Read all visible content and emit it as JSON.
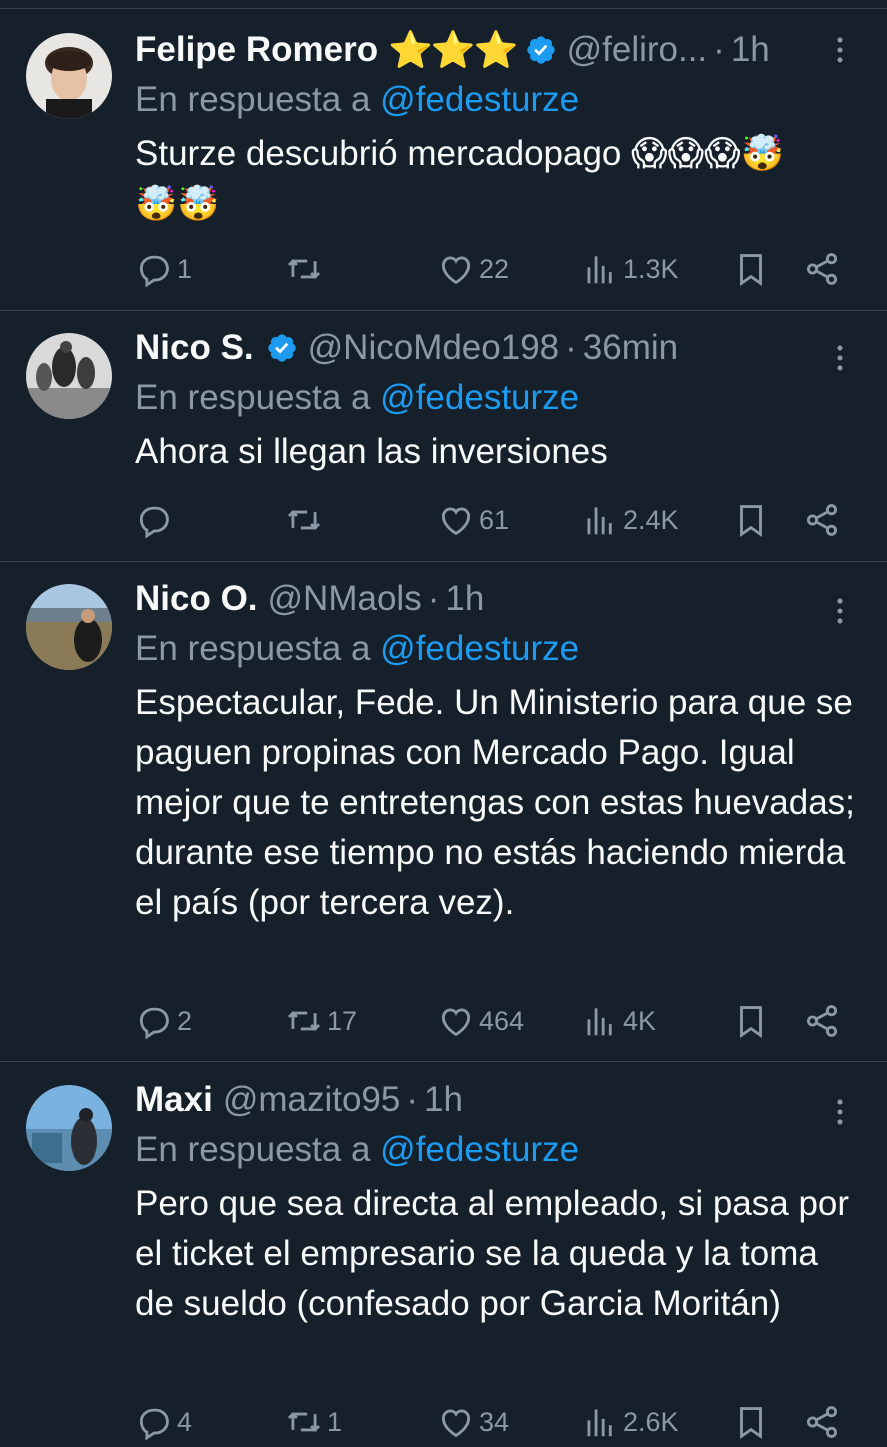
{
  "tweets": [
    {
      "name": "Felipe Romero",
      "stars": "⭐⭐⭐",
      "verified": true,
      "handle": "@feliro...",
      "time": "1h",
      "reply_prefix": "En respuesta a",
      "reply_to": "@fedesturze",
      "text": "Sturze descubrió mercadopago 😱😱😱🤯",
      "text_line2": "🤯🤯",
      "replies": "1",
      "retweets": "",
      "likes": "22",
      "views": "1.3K"
    },
    {
      "name": "Nico S.",
      "verified": true,
      "handle": "@NicoMdeo198",
      "time": "36min",
      "reply_prefix": "En respuesta a",
      "reply_to": "@fedesturze",
      "text": "Ahora si llegan las inversiones",
      "replies": "",
      "retweets": "",
      "likes": "61",
      "views": "2.4K"
    },
    {
      "name": "Nico O.",
      "verified": false,
      "handle": "@NMaols",
      "time": "1h",
      "reply_prefix": "En respuesta a",
      "reply_to": "@fedesturze",
      "text": "Espectacular, Fede. Un Ministerio para que se paguen propinas con Mercado Pago. Igual mejor que te entretengas con estas huevadas; durante ese tiempo no estás haciendo mierda el país (por tercera vez).",
      "replies": "2",
      "retweets": "17",
      "likes": "464",
      "views": "4K"
    },
    {
      "name": "Maxi",
      "verified": false,
      "handle": "@mazito95",
      "time": "1h",
      "reply_prefix": "En respuesta a",
      "reply_to": "@fedesturze",
      "text": "Pero que sea directa al empleado, si pasa por el ticket el empresario se la queda y la toma de sueldo (confesado por Garcia Moritán)",
      "replies": "4",
      "retweets": "1",
      "likes": "34",
      "views": "2.6K"
    }
  ],
  "time_separator": "·",
  "colors": {
    "background": "#15202b",
    "text": "#f7f9f9",
    "secondary": "#8b98a5",
    "link": "#1d9bf0",
    "divider": "#38444d",
    "verified": "#1d9bf0"
  },
  "icons": [
    "reply-icon",
    "retweet-icon",
    "like-icon",
    "views-icon",
    "bookmark-icon",
    "share-icon",
    "more-icon",
    "verified-badge-icon"
  ]
}
